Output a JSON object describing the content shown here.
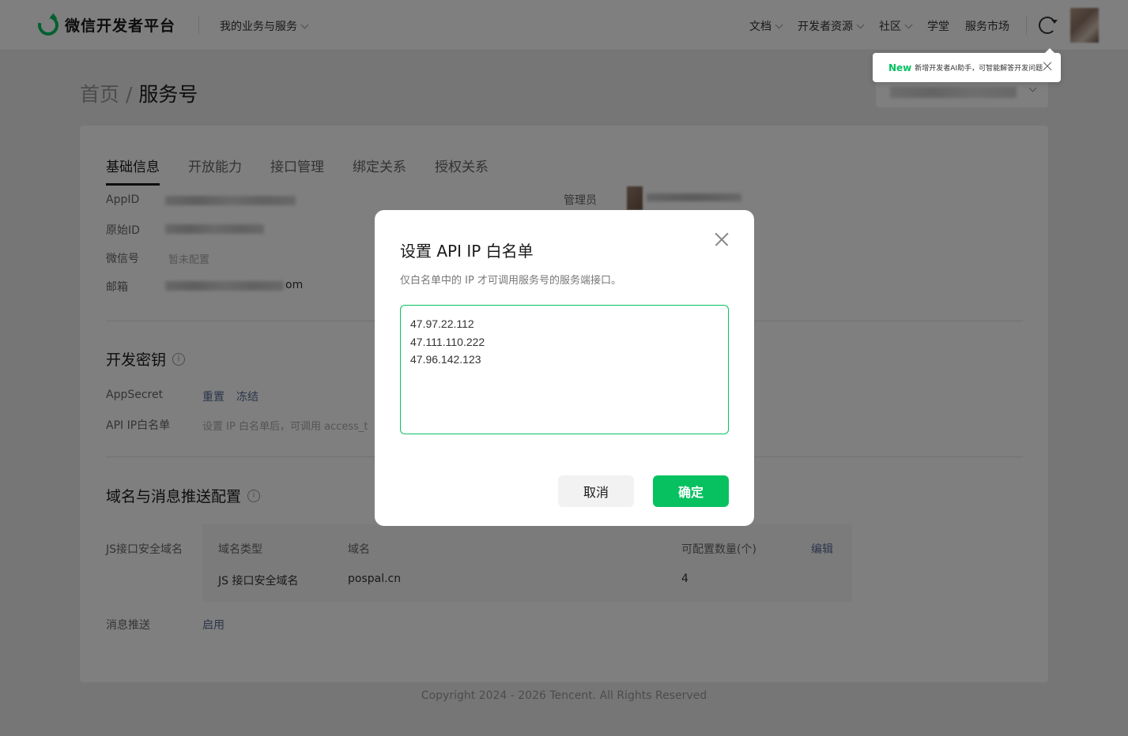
{
  "header": {
    "logo_text": "微信开发者平台",
    "biz_menu": "我的业务与服务",
    "nav": [
      {
        "label": "文档",
        "dropdown": true
      },
      {
        "label": "开发者资源",
        "dropdown": true
      },
      {
        "label": "社区",
        "dropdown": true
      },
      {
        "label": "学堂",
        "dropdown": false
      },
      {
        "label": "服务市场",
        "dropdown": false
      }
    ]
  },
  "tooltip": {
    "badge": "New",
    "text": "新增开发者AI助手，可智能解答开发问题"
  },
  "breadcrumb": {
    "home": "首页",
    "separator": "/",
    "current": "服务号"
  },
  "tabs": [
    "基础信息",
    "开放能力",
    "接口管理",
    "绑定关系",
    "授权关系"
  ],
  "basic_info": {
    "appid_label": "AppID",
    "origin_id_label": "原始ID",
    "wechat_id_label": "微信号",
    "wechat_id_value": "暂未配置",
    "email_label": "邮箱",
    "email_suffix": "om",
    "admin_label": "管理员"
  },
  "dev_key": {
    "title": "开发密钥",
    "appsecret_label": "AppSecret",
    "reset_link": "重置",
    "freeze_link": "冻结",
    "ip_whitelist_label": "API IP白名单",
    "ip_whitelist_hint": "设置 IP 白名单后，可调用 access_t"
  },
  "domain_section": {
    "title": "域名与消息推送配置",
    "js_label": "JS接口安全域名",
    "table": {
      "headers": [
        "域名类型",
        "域名",
        "可配置数量(个)"
      ],
      "edit_link": "编辑",
      "row": [
        "JS 接口安全域名",
        "pospal.cn",
        "4"
      ]
    },
    "push_label": "消息推送",
    "push_link": "启用"
  },
  "footer": "Copyright 2024 - 2026 Tencent. All Rights Reserved",
  "modal": {
    "title": "设置 API IP 白名单",
    "description": "仅白名单中的 IP 才可调用服务号的服务端接口。",
    "ip_text": "47.97.22.112\n47.111.110.222\n47.96.142.123",
    "cancel": "取消",
    "confirm": "确定"
  },
  "colors": {
    "accent": "#07c160",
    "link": "#576b95"
  }
}
